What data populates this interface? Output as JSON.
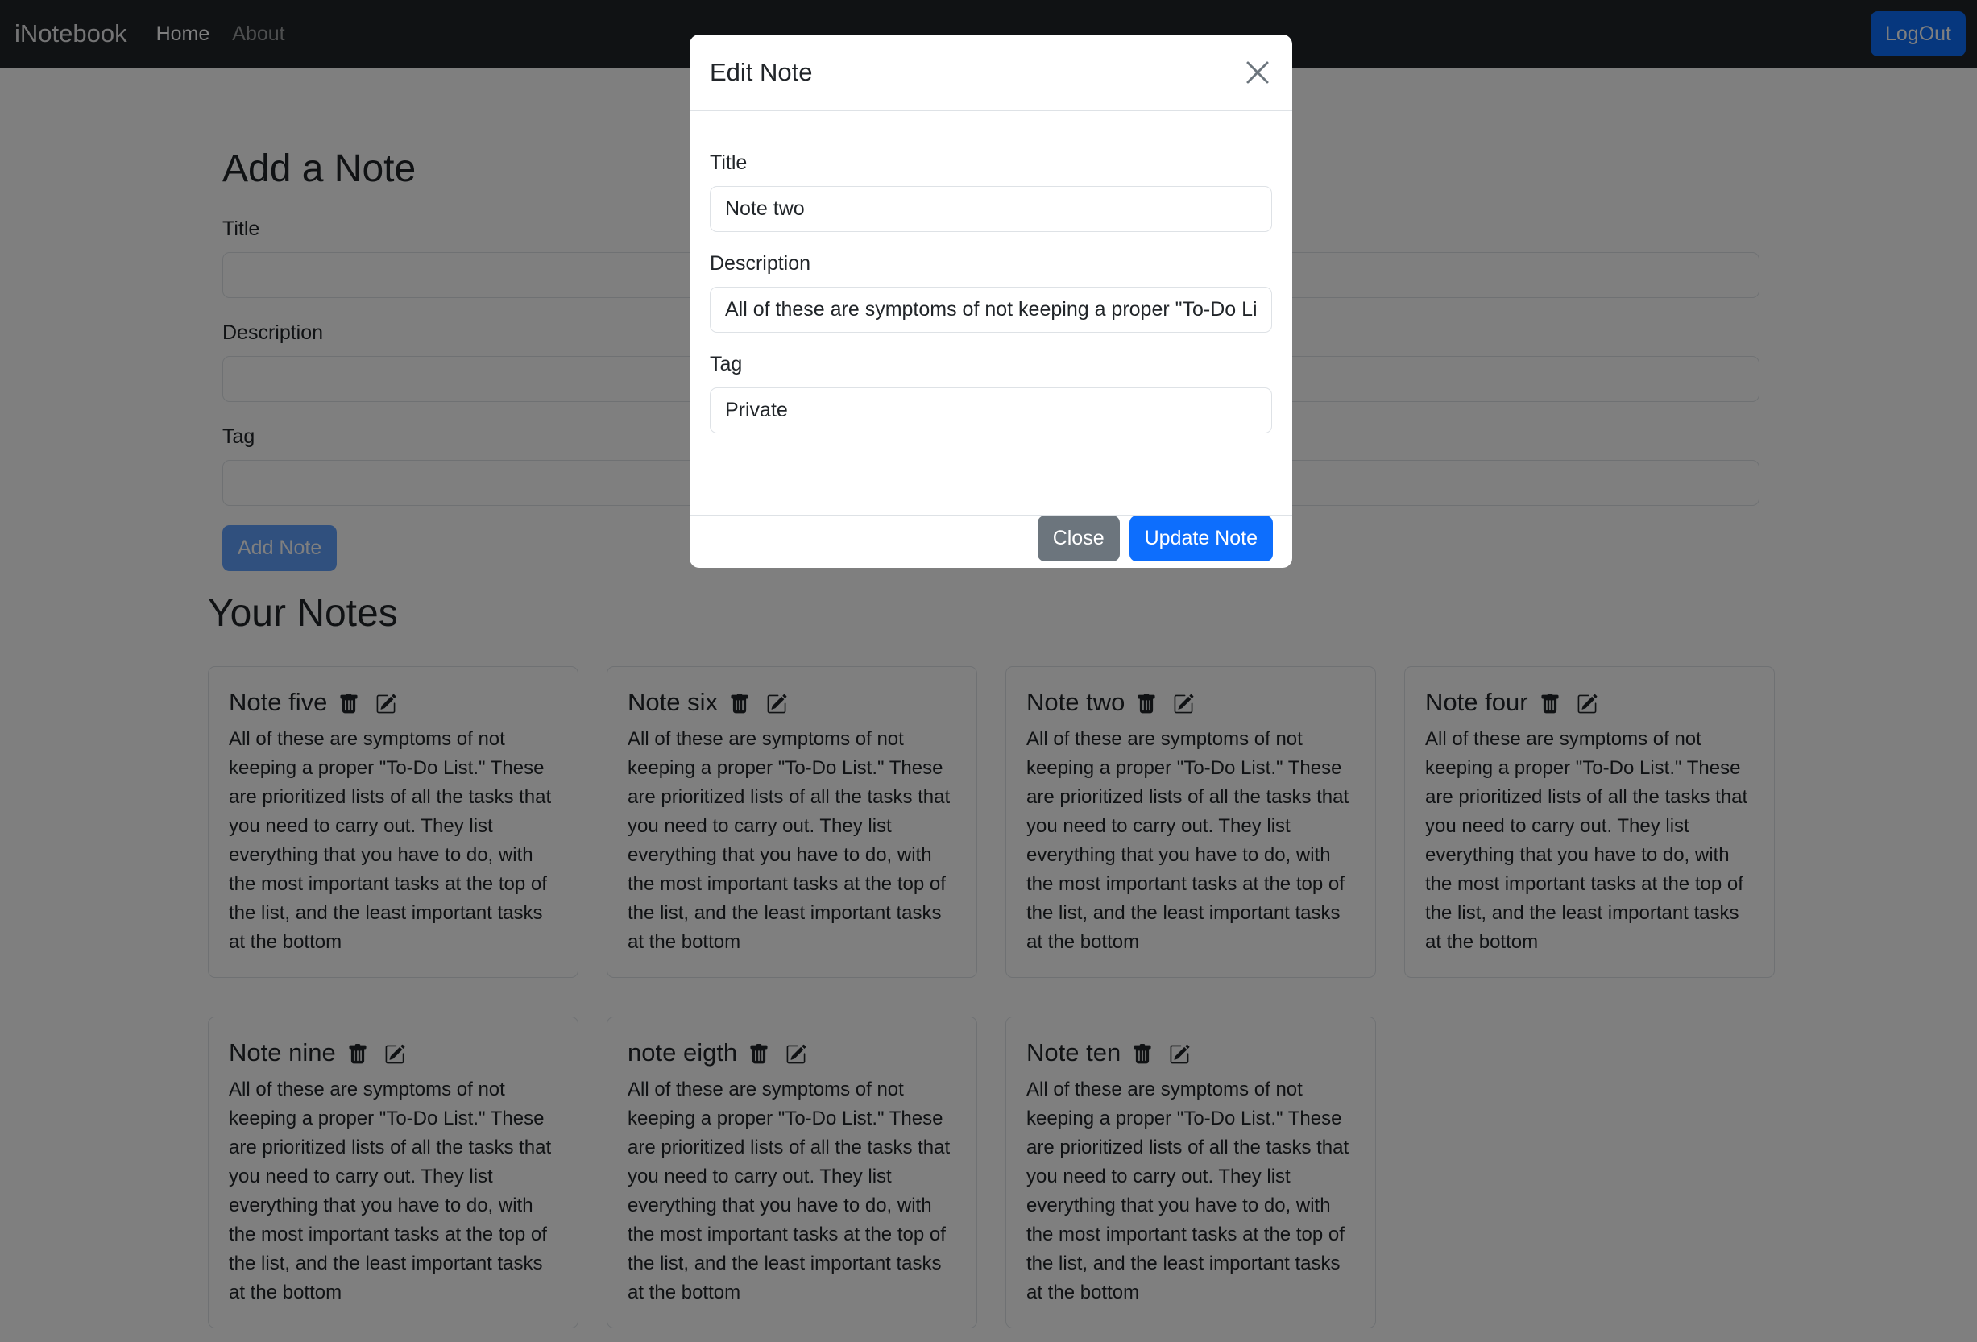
{
  "navbar": {
    "brand": "iNotebook",
    "links": [
      "Home",
      "About"
    ],
    "logout_label": "LogOut"
  },
  "add_form": {
    "heading": "Add a Note",
    "title_label": "Title",
    "description_label": "Description",
    "tag_label": "Tag",
    "submit_label": "Add Note"
  },
  "notes_heading": "Your Notes",
  "notes": [
    {
      "title": "Note five",
      "description": "All of these are symptoms of not keeping a proper \"To-Do List.\" These are prioritized lists of all the tasks that you need to carry out. They list everything that you have to do, with the most important tasks at the top of the list, and the least important tasks at the bottom"
    },
    {
      "title": "Note six",
      "description": "All of these are symptoms of not keeping a proper \"To-Do List.\" These are prioritized lists of all the tasks that you need to carry out. They list everything that you have to do, with the most important tasks at the top of the list, and the least important tasks at the bottom"
    },
    {
      "title": "Note two",
      "description": "All of these are symptoms of not keeping a proper \"To-Do List.\" These are prioritized lists of all the tasks that you need to carry out. They list everything that you have to do, with the most important tasks at the top of the list, and the least important tasks at the bottom"
    },
    {
      "title": "Note four",
      "description": "All of these are symptoms of not keeping a proper \"To-Do List.\" These are prioritized lists of all the tasks that you need to carry out. They list everything that you have to do, with the most important tasks at the top of the list, and the least important tasks at the bottom"
    },
    {
      "title": "Note nine",
      "description": "All of these are symptoms of not keeping a proper \"To-Do List.\" These are prioritized lists of all the tasks that you need to carry out. They list everything that you have to do, with the most important tasks at the top of the list, and the least important tasks at the bottom"
    },
    {
      "title": "note eigth",
      "description": "All of these are symptoms of not keeping a proper \"To-Do List.\" These are prioritized lists of all the tasks that you need to carry out. They list everything that you have to do, with the most important tasks at the top of the list, and the least important tasks at the bottom"
    },
    {
      "title": "Note ten",
      "description": "All of these are symptoms of not keeping a proper \"To-Do List.\" These are prioritized lists of all the tasks that you need to carry out. They list everything that you have to do, with the most important tasks at the top of the list, and the least important tasks at the bottom"
    }
  ],
  "modal": {
    "title": "Edit Note",
    "title_label": "Title",
    "title_value": "Note two",
    "description_label": "Description",
    "description_value": "All of these are symptoms of not keeping a proper \"To-Do List.\" These are prioritized lists of all the tasks that you need to carry out. They list everything that you have to do, with the most important tasks at the top of the list, and the least important tasks at the bottom",
    "tag_label": "Tag",
    "tag_value": "Private",
    "close_label": "Close",
    "update_label": "Update Note"
  },
  "colors": {
    "navbar_bg": "#212529",
    "primary": "#0d6efd",
    "secondary": "#6c757d"
  },
  "icons": {
    "card_delete": "trash-icon",
    "card_edit": "edit-icon",
    "modal_close": "close-icon"
  }
}
